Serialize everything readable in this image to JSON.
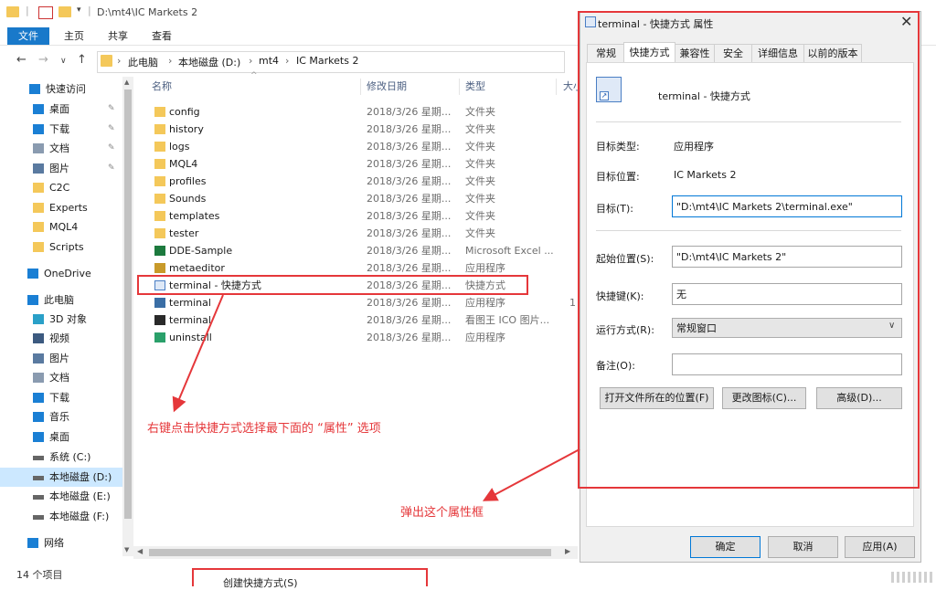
{
  "window": {
    "title": "D:\\mt4\\IC Markets 2",
    "ribbon_file": "文件",
    "ribbon_tabs": [
      "主页",
      "共享",
      "查看"
    ]
  },
  "address": {
    "crumbs": [
      "此电脑",
      "本地磁盘 (D:)",
      "mt4",
      "IC Markets 2"
    ]
  },
  "sidebar": {
    "items": [
      {
        "label": "快速访问",
        "icon": "star-icon",
        "pinned": false
      },
      {
        "label": "桌面",
        "icon": "desktop-icon",
        "pinned": true
      },
      {
        "label": "下载",
        "icon": "download-icon",
        "pinned": true
      },
      {
        "label": "文档",
        "icon": "document-icon",
        "pinned": true
      },
      {
        "label": "图片",
        "icon": "picture-icon",
        "pinned": true
      },
      {
        "label": "C2C",
        "icon": "folder-icon",
        "pinned": false
      },
      {
        "label": "Experts",
        "icon": "folder-icon",
        "pinned": false
      },
      {
        "label": "MQL4",
        "icon": "folder-icon",
        "pinned": false
      },
      {
        "label": "Scripts",
        "icon": "folder-icon",
        "pinned": false
      },
      {
        "label": "OneDrive",
        "icon": "cloud-icon",
        "pinned": false
      },
      {
        "label": "此电脑",
        "icon": "pc-icon",
        "pinned": false
      },
      {
        "label": "3D 对象",
        "icon": "cube-icon",
        "pinned": false
      },
      {
        "label": "视频",
        "icon": "video-icon",
        "pinned": false
      },
      {
        "label": "图片",
        "icon": "picture-icon",
        "pinned": false
      },
      {
        "label": "文档",
        "icon": "document-icon",
        "pinned": false
      },
      {
        "label": "下载",
        "icon": "download-icon",
        "pinned": false
      },
      {
        "label": "音乐",
        "icon": "music-icon",
        "pinned": false
      },
      {
        "label": "桌面",
        "icon": "desktop-icon",
        "pinned": false
      },
      {
        "label": "系统 (C:)",
        "icon": "drive-icon",
        "pinned": false
      },
      {
        "label": "本地磁盘 (D:)",
        "icon": "drive-icon",
        "pinned": false
      },
      {
        "label": "本地磁盘 (E:)",
        "icon": "drive-icon",
        "pinned": false
      },
      {
        "label": "本地磁盘 (F:)",
        "icon": "drive-icon",
        "pinned": false
      },
      {
        "label": "网络",
        "icon": "network-icon",
        "pinned": false
      }
    ]
  },
  "columns": {
    "name": "名称",
    "date": "修改日期",
    "type": "类型",
    "size": "大小"
  },
  "files": [
    {
      "name": "config",
      "date": "2018/3/26 星期...",
      "type": "文件夹",
      "icon": "folder-icon",
      "size": ""
    },
    {
      "name": "history",
      "date": "2018/3/26 星期...",
      "type": "文件夹",
      "icon": "folder-icon",
      "size": ""
    },
    {
      "name": "logs",
      "date": "2018/3/26 星期...",
      "type": "文件夹",
      "icon": "folder-icon",
      "size": ""
    },
    {
      "name": "MQL4",
      "date": "2018/3/26 星期...",
      "type": "文件夹",
      "icon": "folder-icon",
      "size": ""
    },
    {
      "name": "profiles",
      "date": "2018/3/26 星期...",
      "type": "文件夹",
      "icon": "folder-icon",
      "size": ""
    },
    {
      "name": "Sounds",
      "date": "2018/3/26 星期...",
      "type": "文件夹",
      "icon": "folder-icon",
      "size": ""
    },
    {
      "name": "templates",
      "date": "2018/3/26 星期...",
      "type": "文件夹",
      "icon": "folder-icon",
      "size": ""
    },
    {
      "name": "tester",
      "date": "2018/3/26 星期...",
      "type": "文件夹",
      "icon": "folder-icon",
      "size": ""
    },
    {
      "name": "DDE-Sample",
      "date": "2018/3/26 星期...",
      "type": "Microsoft Excel ...",
      "icon": "excel-icon",
      "size": ""
    },
    {
      "name": "metaeditor",
      "date": "2018/3/26 星期...",
      "type": "应用程序",
      "icon": "metaeditor-icon",
      "size": ""
    },
    {
      "name": "terminal - 快捷方式",
      "date": "2018/3/26 星期...",
      "type": "快捷方式",
      "icon": "shortcut-icon",
      "size": ""
    },
    {
      "name": "terminal",
      "date": "2018/3/26 星期...",
      "type": "应用程序",
      "icon": "app-icon",
      "size": "1"
    },
    {
      "name": "terminal",
      "date": "2018/3/26 星期...",
      "type": "看图王 ICO 图片...",
      "icon": "ico-icon",
      "size": ""
    },
    {
      "name": "uninstall",
      "date": "2018/3/26 星期...",
      "type": "应用程序",
      "icon": "uninstall-icon",
      "size": ""
    }
  ],
  "status": {
    "count": "14 个项目",
    "context_menu_fragment": "创建快捷方式(S)"
  },
  "dialog": {
    "title": "terminal - 快捷方式 属性",
    "tabs_row1": [
      "常规",
      "快捷方式",
      "兼容性",
      "安全",
      "详细信息",
      "以前的版本"
    ],
    "header_name": "terminal - 快捷方式",
    "target_type_label": "目标类型:",
    "target_type_value": "应用程序",
    "target_loc_label": "目标位置:",
    "target_loc_value": "IC Markets 2",
    "target_label": "目标(T):",
    "target_value": "\"D:\\mt4\\IC Markets 2\\terminal.exe\"",
    "start_label": "起始位置(S):",
    "start_value": "\"D:\\mt4\\IC Markets 2\"",
    "hotkey_label": "快捷键(K):",
    "hotkey_value": "无",
    "run_label": "运行方式(R):",
    "run_value": "常规窗口",
    "comment_label": "备注(O):",
    "comment_value": "",
    "btn_open_location": "打开文件所在的位置(F)",
    "btn_change_icon": "更改图标(C)...",
    "btn_advanced": "高级(D)...",
    "btn_ok": "确定",
    "btn_cancel": "取消",
    "btn_apply": "应用(A)"
  },
  "annotations": {
    "left_note": "右键点击快捷方式选择最下面的 “属性” 选项",
    "right_note": "弹出这个属性框",
    "color": "#e5373a"
  }
}
